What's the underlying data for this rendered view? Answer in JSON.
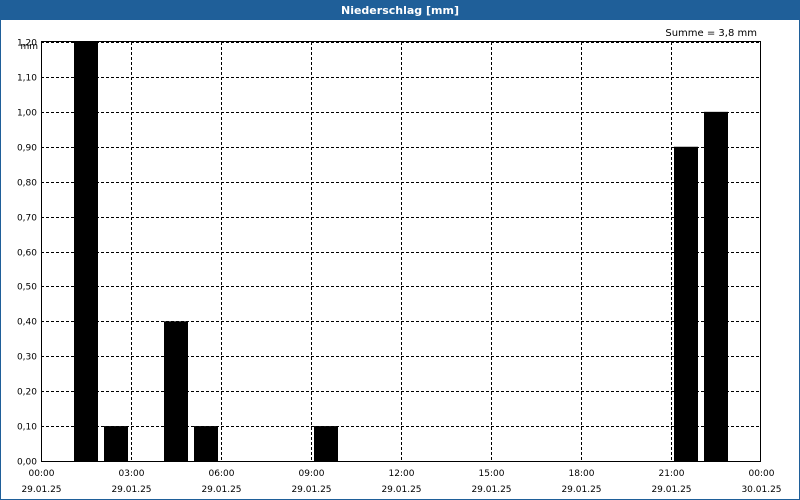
{
  "window": {
    "title": "Niederschlag [mm]"
  },
  "chart_data": {
    "type": "bar",
    "title": "Niederschlag [mm]",
    "ylabel": "mm",
    "xlabel": "",
    "annotation": "Summe = 3,8 mm",
    "ylim": [
      0,
      1.2
    ],
    "y_ticks": [
      "0,00",
      "0,10",
      "0,20",
      "0,30",
      "0,40",
      "0,50",
      "0,60",
      "0,70",
      "0,80",
      "0,90",
      "1,00",
      "1,10",
      "1,20"
    ],
    "xlim": [
      "29.01.25 00:00",
      "30.01.25 00:00"
    ],
    "x_ticks": [
      {
        "time": "00:00",
        "date": "29.01.25"
      },
      {
        "time": "03:00",
        "date": "29.01.25"
      },
      {
        "time": "06:00",
        "date": "29.01.25"
      },
      {
        "time": "09:00",
        "date": "29.01.25"
      },
      {
        "time": "12:00",
        "date": "29.01.25"
      },
      {
        "time": "15:00",
        "date": "29.01.25"
      },
      {
        "time": "18:00",
        "date": "29.01.25"
      },
      {
        "time": "21:00",
        "date": "29.01.25"
      },
      {
        "time": "00:00",
        "date": "30.01.25"
      }
    ],
    "interval": "1 h",
    "categories": [
      "29.01.25 02:00",
      "29.01.25 03:00",
      "29.01.25 05:00",
      "29.01.25 06:00",
      "29.01.25 10:00",
      "29.01.25 22:00",
      "29.01.25 23:00"
    ],
    "values": [
      1.2,
      0.1,
      0.4,
      0.1,
      0.1,
      0.9,
      1.0
    ],
    "grid": true,
    "bar_color": "#000000"
  }
}
